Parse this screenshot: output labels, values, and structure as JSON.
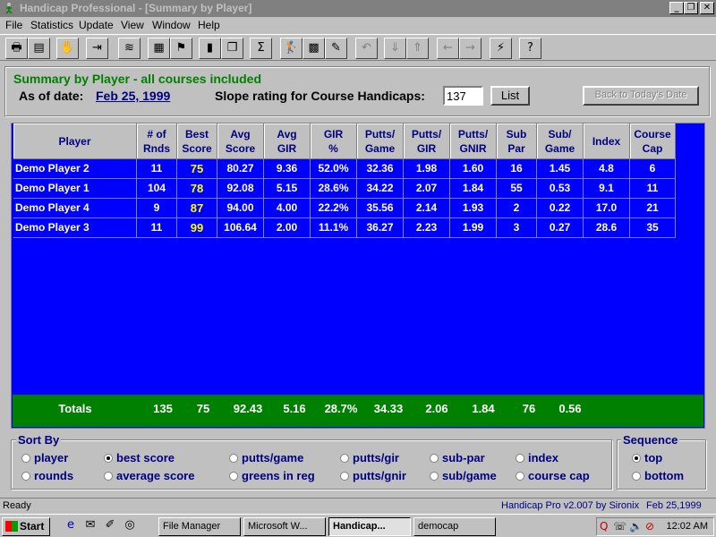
{
  "window": {
    "title": "Handicap Professional - [Summary by Player]",
    "controls": [
      "_",
      "❐",
      "✕"
    ]
  },
  "menu": [
    "File",
    "Statistics",
    "Update",
    "View",
    "Window",
    "Help"
  ],
  "toolbar": {
    "tools": [
      {
        "name": "print-icon",
        "glyph": "🖶"
      },
      {
        "name": "report-icon",
        "glyph": "▤"
      },
      {
        "name": "stop-hand-icon",
        "glyph": "✋"
      },
      {
        "name": "exit-door-icon",
        "glyph": "⇥"
      },
      {
        "name": "broom-icon",
        "glyph": "≋"
      },
      {
        "name": "calculator-icon",
        "glyph": "▦"
      },
      {
        "name": "flag-icon",
        "glyph": "⚑"
      },
      {
        "name": "bar-chart-icon",
        "glyph": "▮"
      },
      {
        "name": "copy-icon",
        "glyph": "❐"
      },
      {
        "name": "sigma-icon",
        "glyph": "Σ"
      },
      {
        "name": "golfer-icon",
        "glyph": "🏌"
      },
      {
        "name": "course-map-icon",
        "glyph": "▩"
      },
      {
        "name": "edit-card-icon",
        "glyph": "✎"
      },
      {
        "name": "undo-icon",
        "glyph": "↶"
      },
      {
        "name": "move-down-icon",
        "glyph": "⇓"
      },
      {
        "name": "move-up-icon",
        "glyph": "⇑"
      },
      {
        "name": "back-arrow-icon",
        "glyph": "←"
      },
      {
        "name": "forward-arrow-icon",
        "glyph": "→"
      },
      {
        "name": "lightning-icon",
        "glyph": "⚡"
      },
      {
        "name": "help-question-icon",
        "glyph": "?"
      }
    ]
  },
  "header": {
    "summary_title": "Summary by Player  -  all courses included",
    "as_of_label": "As of date:",
    "as_of_date": "Feb 25, 1999",
    "slope_label": "Slope rating for Course Handicaps:",
    "slope_value": "137",
    "list_label": "List",
    "back_label": "Back to Today's Date"
  },
  "table": {
    "columns": [
      "Player",
      "# of\nRnds",
      "Best\nScore",
      "Avg\nScore",
      "Avg\nGIR",
      "GIR\n%",
      "Putts/\nGame",
      "Putts/\nGIR",
      "Putts/\nGNIR",
      "Sub\nPar",
      "Sub/\nGame",
      "Index",
      "Course\nCap"
    ],
    "rows": [
      [
        "Demo Player 2",
        "11",
        "75",
        "80.27",
        "9.36",
        "52.0%",
        "32.36",
        "1.98",
        "1.60",
        "16",
        "1.45",
        "4.8",
        "6"
      ],
      [
        "Demo Player 1",
        "104",
        "78",
        "92.08",
        "5.15",
        "28.6%",
        "34.22",
        "2.07",
        "1.84",
        "55",
        "0.53",
        "9.1",
        "11"
      ],
      [
        "Demo Player 4",
        "9",
        "87",
        "94.00",
        "4.00",
        "22.2%",
        "35.56",
        "2.14",
        "1.93",
        "2",
        "0.22",
        "17.0",
        "21"
      ],
      [
        "Demo Player 3",
        "11",
        "99",
        "106.64",
        "2.00",
        "11.1%",
        "36.27",
        "2.23",
        "1.99",
        "3",
        "0.27",
        "28.6",
        "35"
      ]
    ],
    "totals": [
      "Totals",
      "135",
      "75",
      "92.43",
      "5.16",
      "28.7%",
      "34.33",
      "2.06",
      "1.84",
      "76",
      "0.56"
    ]
  },
  "sort_by": {
    "label": "Sort By",
    "options": [
      "player",
      "rounds",
      "best score",
      "average score",
      "putts/game",
      "greens in reg",
      "putts/gir",
      "putts/gnir",
      "sub-par",
      "sub/game",
      "index",
      "course cap"
    ],
    "selected": "best score"
  },
  "sequence": {
    "label": "Sequence",
    "options": [
      "top",
      "bottom"
    ],
    "selected": "top"
  },
  "status": {
    "left": "Ready",
    "version": "Handicap Pro v2.007 by Sironix",
    "date": "Feb 25,1999"
  },
  "taskbar": {
    "start": "Start",
    "tasks": [
      "File Manager",
      "Microsoft W...",
      "Handicap...",
      "democap"
    ],
    "active_task": "Handicap...",
    "clock": "12:02 AM"
  }
}
